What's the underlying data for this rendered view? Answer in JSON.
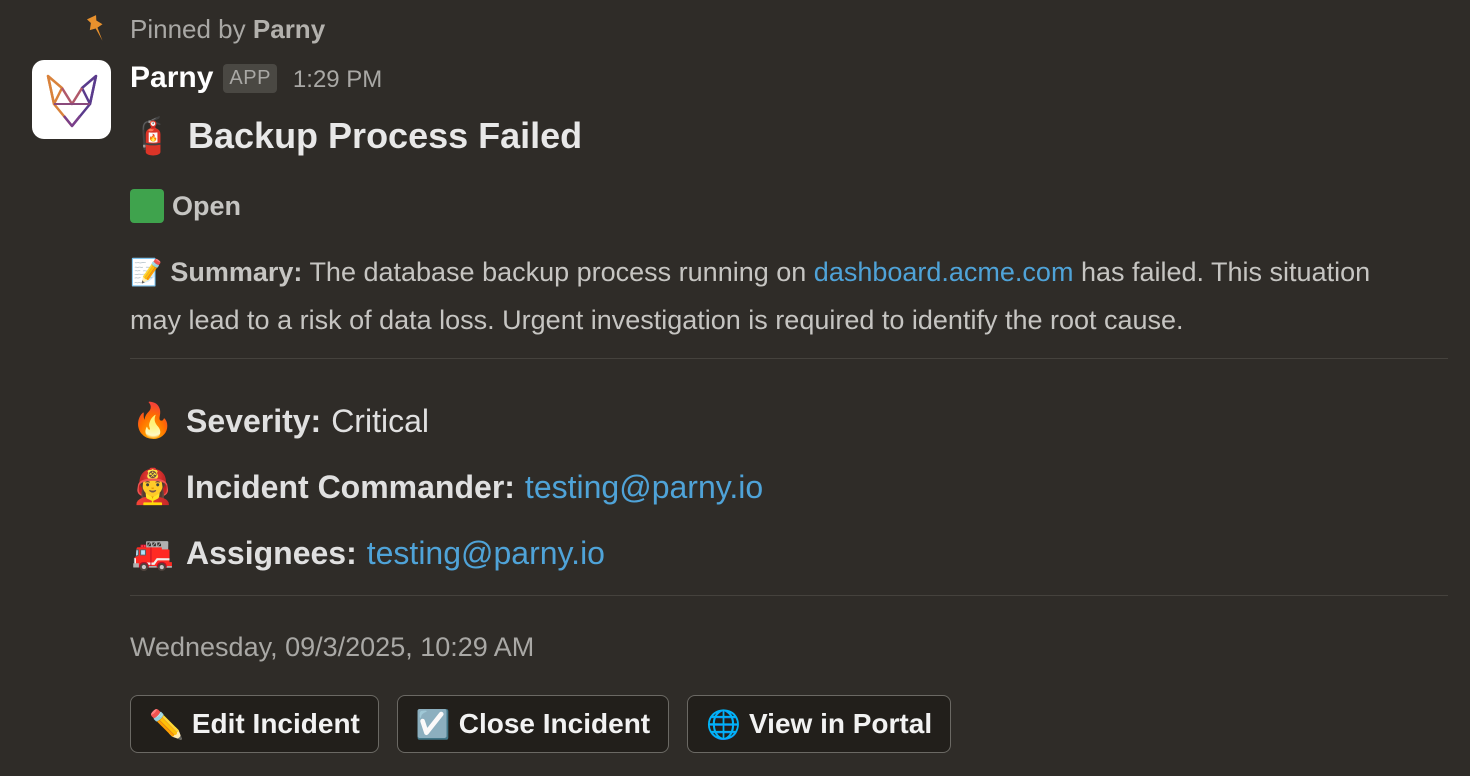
{
  "pinned": {
    "prefix": "Pinned by",
    "by": "Parny",
    "icon": "pin-icon"
  },
  "message": {
    "sender": "Parny",
    "badge": "APP",
    "time": "1:29 PM",
    "avatar_icon": "parny-fox-logo"
  },
  "incident": {
    "title_emoji": "🧯",
    "title": "Backup Process Failed",
    "status": "Open",
    "status_color": "#3fa34d",
    "summary": {
      "emoji": "📝",
      "label": "Summary:",
      "text_before": "The database backup process running on",
      "link": "dashboard.acme.com",
      "text_after": "has failed. This situation may lead to a risk of data loss. Urgent investigation is required to identify the root cause."
    },
    "severity": {
      "emoji": "🔥",
      "label": "Severity:",
      "value": "Critical"
    },
    "commander": {
      "emoji": "👩‍🚒",
      "label": "Incident Commander:",
      "value": "testing@parny.io"
    },
    "assignees": {
      "emoji": "🚒",
      "label": "Assignees:",
      "value": "testing@parny.io"
    },
    "datetime": "Wednesday, 09/3/2025, 10:29 AM"
  },
  "buttons": {
    "edit": {
      "emoji": "✏️",
      "label": "Edit Incident"
    },
    "close": {
      "emoji": "☑️",
      "label": "Close Incident"
    },
    "portal": {
      "emoji": "🌐",
      "label": "View in Portal"
    }
  },
  "colors": {
    "background": "#2f2c28",
    "link": "#4fa3d8",
    "pin": "#e8912d"
  }
}
